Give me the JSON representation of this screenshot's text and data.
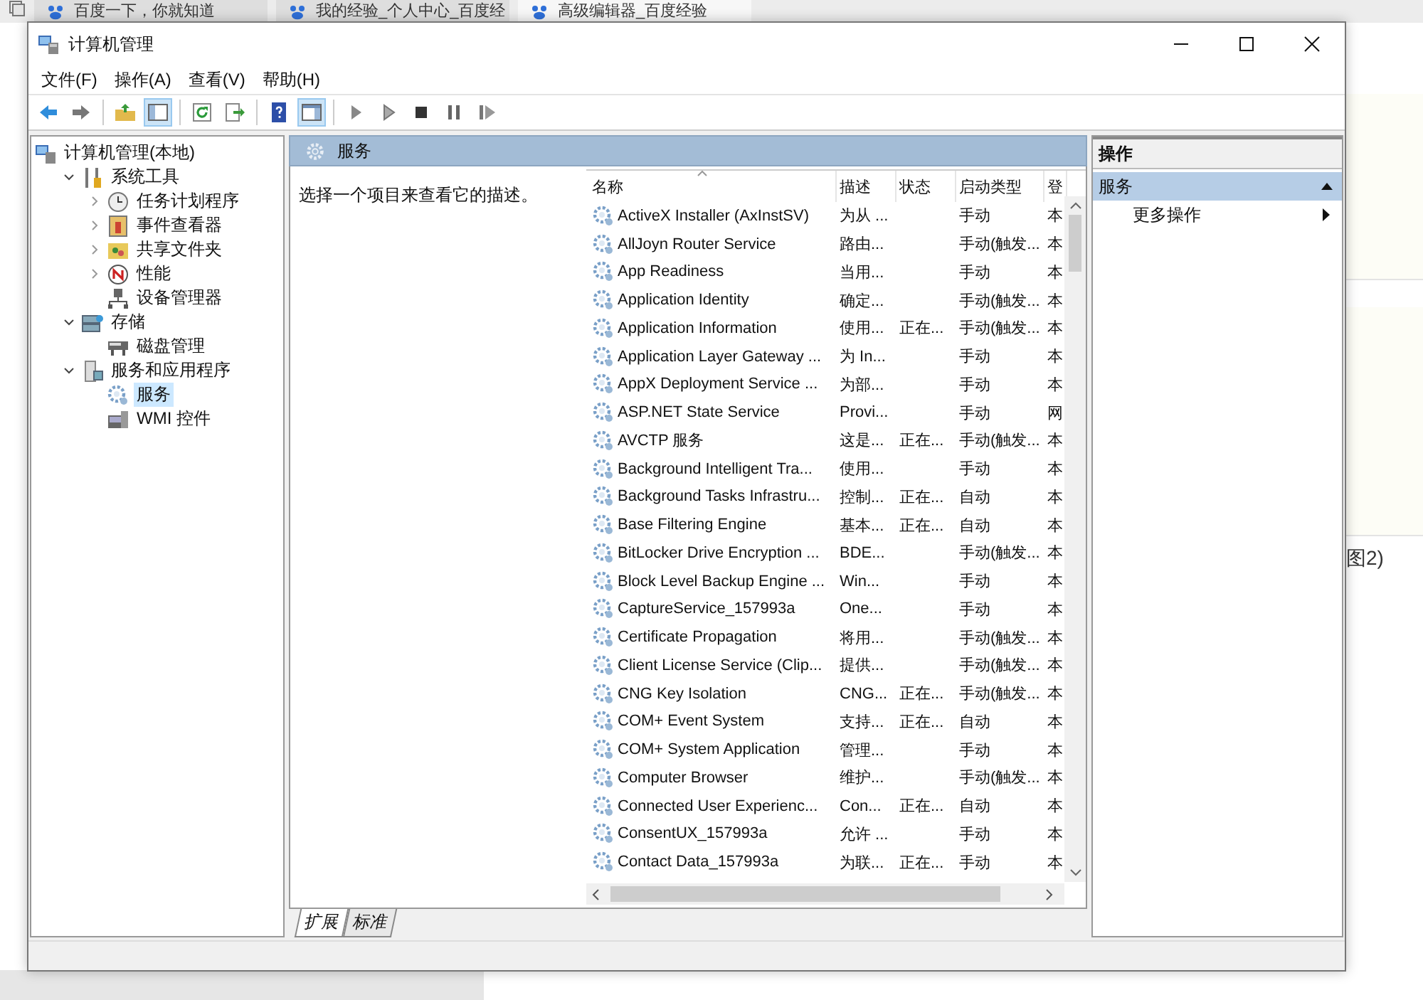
{
  "browser": {
    "tabs": [
      {
        "label": "百度一下，你就知道",
        "selected": false
      },
      {
        "label": "我的经验_个人中心_百度经",
        "selected": false
      },
      {
        "label": "高级编辑器_百度经验",
        "selected": true
      }
    ],
    "page_text": "图2)"
  },
  "window": {
    "title": "计算机管理"
  },
  "menu": [
    "文件(F)",
    "操作(A)",
    "查看(V)",
    "帮助(H)"
  ],
  "toolbar": [
    {
      "kind": "back",
      "pressed": false
    },
    {
      "kind": "forward",
      "pressed": false
    },
    {
      "kind": "sep"
    },
    {
      "kind": "up",
      "pressed": false
    },
    {
      "kind": "tree",
      "pressed": true
    },
    {
      "kind": "sep"
    },
    {
      "kind": "refresh",
      "pressed": false
    },
    {
      "kind": "export",
      "pressed": false
    },
    {
      "kind": "sep"
    },
    {
      "kind": "help",
      "pressed": false
    },
    {
      "kind": "pane",
      "pressed": true
    },
    {
      "kind": "sep"
    },
    {
      "kind": "play",
      "pressed": false
    },
    {
      "kind": "play2",
      "pressed": false
    },
    {
      "kind": "stop",
      "pressed": false
    },
    {
      "kind": "pause",
      "pressed": false
    },
    {
      "kind": "resume",
      "pressed": false
    }
  ],
  "tree": [
    {
      "label": "计算机管理(本地)",
      "kind": "computer",
      "selected": false,
      "children": [
        {
          "label": "系统工具",
          "kind": "tools",
          "expanded": true,
          "selected": false,
          "children": [
            {
              "label": "任务计划程序",
              "kind": "clock",
              "expanded": false,
              "selected": false
            },
            {
              "label": "事件查看器",
              "kind": "event",
              "expanded": false,
              "selected": false
            },
            {
              "label": "共享文件夹",
              "kind": "share",
              "expanded": false,
              "selected": false
            },
            {
              "label": "性能",
              "kind": "perf",
              "expanded": false,
              "selected": false
            },
            {
              "label": "设备管理器",
              "kind": "device",
              "selected": false
            }
          ]
        },
        {
          "label": "存储",
          "kind": "storage",
          "expanded": true,
          "selected": false,
          "children": [
            {
              "label": "磁盘管理",
              "kind": "disk",
              "selected": false
            }
          ]
        },
        {
          "label": "服务和应用程序",
          "kind": "apps",
          "expanded": true,
          "selected": false,
          "children": [
            {
              "label": "服务",
              "kind": "services",
              "selected": true
            },
            {
              "label": "WMI 控件",
              "kind": "wmi",
              "selected": false
            }
          ]
        }
      ]
    }
  ],
  "center": {
    "title": "服务",
    "description": "选择一个项目来查看它的描述。",
    "columns": [
      "名称",
      "描述",
      "状态",
      "启动类型",
      "登"
    ],
    "rows": [
      [
        "ActiveX Installer (AxInstSV)",
        "为从 ...",
        "",
        "手动",
        "本"
      ],
      [
        "AllJoyn Router Service",
        "路由...",
        "",
        "手动(触发...",
        "本"
      ],
      [
        "App Readiness",
        "当用...",
        "",
        "手动",
        "本"
      ],
      [
        "Application Identity",
        "确定...",
        "",
        "手动(触发...",
        "本"
      ],
      [
        "Application Information",
        "使用...",
        "正在...",
        "手动(触发...",
        "本"
      ],
      [
        "Application Layer Gateway ...",
        "为 In...",
        "",
        "手动",
        "本"
      ],
      [
        "AppX Deployment Service ...",
        "为部...",
        "",
        "手动",
        "本"
      ],
      [
        "ASP.NET State Service",
        "Provi...",
        "",
        "手动",
        "网"
      ],
      [
        "AVCTP 服务",
        "这是...",
        "正在...",
        "手动(触发...",
        "本"
      ],
      [
        "Background Intelligent Tra...",
        "使用...",
        "",
        "手动",
        "本"
      ],
      [
        "Background Tasks Infrastru...",
        "控制...",
        "正在...",
        "自动",
        "本"
      ],
      [
        "Base Filtering Engine",
        "基本...",
        "正在...",
        "自动",
        "本"
      ],
      [
        "BitLocker Drive Encryption ...",
        "BDE...",
        "",
        "手动(触发...",
        "本"
      ],
      [
        "Block Level Backup Engine ...",
        "Win...",
        "",
        "手动",
        "本"
      ],
      [
        "CaptureService_157993a",
        "One...",
        "",
        "手动",
        "本"
      ],
      [
        "Certificate Propagation",
        "将用...",
        "",
        "手动(触发...",
        "本"
      ],
      [
        "Client License Service (Clip...",
        "提供...",
        "",
        "手动(触发...",
        "本"
      ],
      [
        "CNG Key Isolation",
        "CNG...",
        "正在...",
        "手动(触发...",
        "本"
      ],
      [
        "COM+ Event System",
        "支持...",
        "正在...",
        "自动",
        "本"
      ],
      [
        "COM+ System Application",
        "管理...",
        "",
        "手动",
        "本"
      ],
      [
        "Computer Browser",
        "维护...",
        "",
        "手动(触发...",
        "本"
      ],
      [
        "Connected User Experienc...",
        "Con...",
        "正在...",
        "自动",
        "本"
      ],
      [
        "ConsentUX_157993a",
        "允许 ...",
        "",
        "手动",
        "本"
      ],
      [
        "Contact Data_157993a",
        "为联...",
        "正在...",
        "手动",
        "本"
      ]
    ],
    "bottom_tabs": [
      {
        "label": "扩展",
        "selected": true
      },
      {
        "label": "标准",
        "selected": false
      }
    ]
  },
  "actions": {
    "title": "操作",
    "section": {
      "label": "服务",
      "expanded": true
    },
    "items": [
      "更多操作"
    ]
  }
}
